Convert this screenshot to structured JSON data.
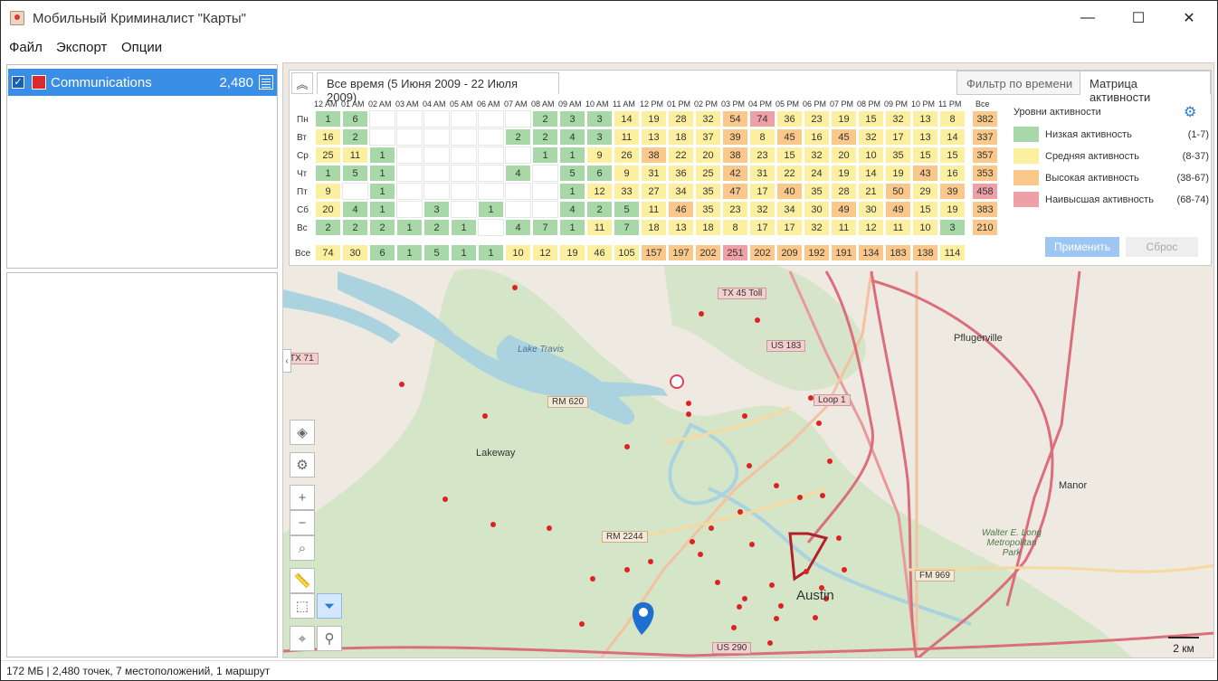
{
  "window": {
    "title": "Мобильный Криминалист \"Карты\"",
    "minimize": "—",
    "maximize": "☐",
    "close": "✕"
  },
  "menu": [
    "Файл",
    "Экспорт",
    "Опции"
  ],
  "layers": [
    {
      "name": "Communications",
      "count": "2,480",
      "checked": true,
      "color": "#d92b2b"
    }
  ],
  "panel": {
    "range_label": "Все время (5 Июня 2009 - 22 Июля 2009)",
    "tabs": [
      "Фильтр по времени",
      "Матрица активности"
    ],
    "active_tab": 1,
    "hours": [
      "12 AM",
      "01 AM",
      "02 AM",
      "03 AM",
      "04 AM",
      "05 AM",
      "06 AM",
      "07 AM",
      "08 AM",
      "09 AM",
      "10 AM",
      "11 AM",
      "12 PM",
      "01 PM",
      "02 PM",
      "03 PM",
      "04 PM",
      "05 PM",
      "06 PM",
      "07 PM",
      "08 PM",
      "09 PM",
      "10 PM",
      "11 PM"
    ],
    "total_header": "Все",
    "days": [
      "Пн",
      "Вт",
      "Ср",
      "Чт",
      "Пт",
      "Сб",
      "Вс"
    ],
    "matrix": [
      [
        1,
        6,
        0,
        0,
        0,
        0,
        0,
        0,
        2,
        3,
        3,
        14,
        19,
        28,
        32,
        54,
        74,
        36,
        23,
        19,
        15,
        32,
        13,
        8
      ],
      [
        16,
        2,
        0,
        0,
        0,
        0,
        0,
        2,
        2,
        4,
        3,
        11,
        13,
        18,
        37,
        39,
        8,
        45,
        16,
        45,
        32,
        17,
        13,
        14
      ],
      [
        25,
        11,
        1,
        0,
        0,
        0,
        0,
        0,
        1,
        1,
        9,
        26,
        38,
        22,
        20,
        38,
        23,
        15,
        32,
        20,
        10,
        35,
        15,
        15
      ],
      [
        1,
        5,
        1,
        0,
        0,
        0,
        0,
        4,
        0,
        5,
        6,
        9,
        31,
        36,
        25,
        42,
        31,
        22,
        24,
        19,
        14,
        19,
        43,
        16
      ],
      [
        9,
        0,
        1,
        0,
        0,
        0,
        0,
        0,
        0,
        1,
        12,
        33,
        27,
        34,
        35,
        47,
        17,
        40,
        35,
        28,
        21,
        50,
        29,
        39
      ],
      [
        20,
        4,
        1,
        0,
        3,
        0,
        1,
        0,
        0,
        4,
        2,
        5,
        11,
        46,
        35,
        23,
        32,
        34,
        30,
        49,
        30,
        49,
        15,
        19
      ],
      [
        2,
        2,
        2,
        1,
        2,
        1,
        0,
        4,
        7,
        1,
        11,
        7,
        18,
        13,
        18,
        8,
        17,
        17,
        32,
        11,
        12,
        11,
        10,
        3
      ]
    ],
    "row_totals": [
      382,
      337,
      357,
      353,
      458,
      383,
      210
    ],
    "totals_label": "Все",
    "col_totals": [
      74,
      30,
      6,
      1,
      5,
      1,
      1,
      10,
      12,
      19,
      46,
      105,
      157,
      197,
      202,
      251,
      202,
      209,
      192,
      191,
      134,
      183,
      138,
      114
    ],
    "legend": {
      "title": "Уровни активности",
      "levels": [
        {
          "label": "Низкая активность",
          "range": "(1-7)",
          "color": "#a8d8a8"
        },
        {
          "label": "Средняя активность",
          "range": "(8-37)",
          "color": "#fcf0a0"
        },
        {
          "label": "Высокая активность",
          "range": "(38-67)",
          "color": "#f9c88a"
        },
        {
          "label": "Наивысшая активность",
          "range": "(68-74)",
          "color": "#efa0a6"
        }
      ]
    },
    "apply": "Применить",
    "reset": "Сброс"
  },
  "map": {
    "labels": [
      "Lake Travis",
      "Lakeway",
      "Austin",
      "Pflugerville",
      "Manor",
      "Walter E. Long Metropolitan Park"
    ],
    "roads": [
      "TX 45 Toll",
      "US 183",
      "Loop 1",
      "RM 620",
      "RM 2244",
      "FM 969",
      "TX 71",
      "US 290"
    ],
    "scale": "2 км"
  },
  "status": "172 МБ | 2,480 точек, 7 местоположений, 1 маршрут"
}
